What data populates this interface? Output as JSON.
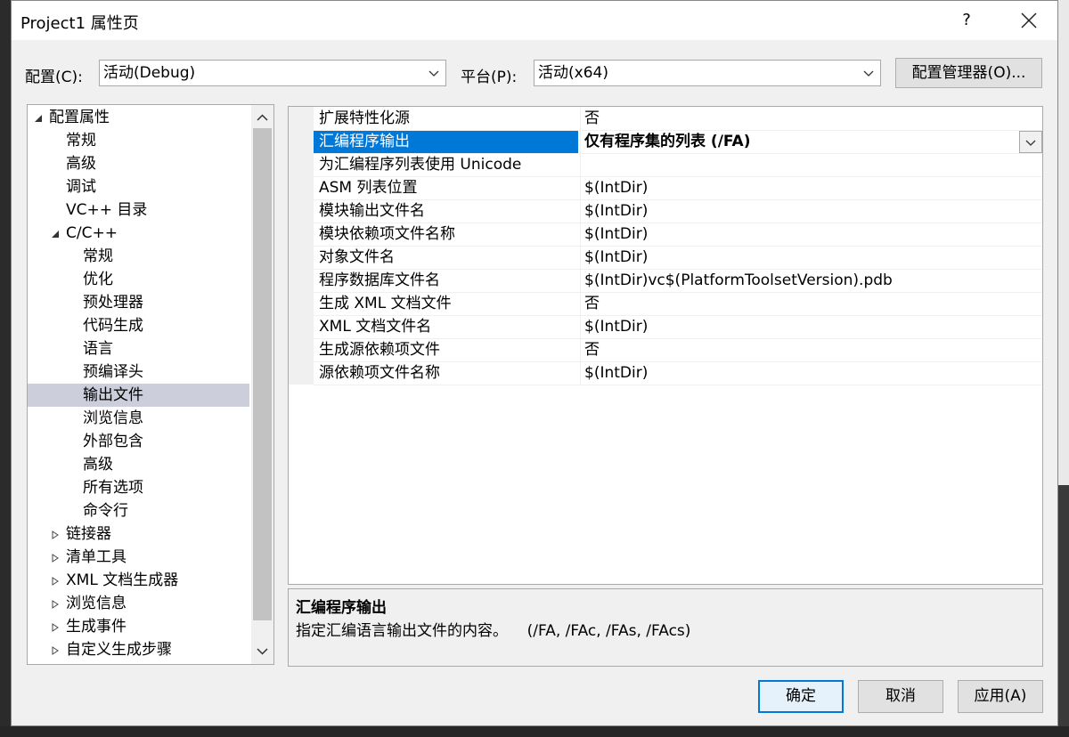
{
  "window": {
    "title": "Project1 属性页",
    "help": "?"
  },
  "config": {
    "label": "配置(C):",
    "value": "活动(Debug)",
    "platform_label": "平台(P):",
    "platform_value": "活动(x64)",
    "manager_button": "配置管理器(O)..."
  },
  "tree": {
    "items": [
      {
        "label": "配置属性",
        "expander": "expanded"
      },
      {
        "label": "常规"
      },
      {
        "label": "高级"
      },
      {
        "label": "调试"
      },
      {
        "label": "VC++ 目录"
      },
      {
        "label": "C/C++",
        "expander": "expanded"
      },
      {
        "label": "常规"
      },
      {
        "label": "优化"
      },
      {
        "label": "预处理器"
      },
      {
        "label": "代码生成"
      },
      {
        "label": "语言"
      },
      {
        "label": "预编译头"
      },
      {
        "label": "输出文件",
        "selected": true
      },
      {
        "label": "浏览信息"
      },
      {
        "label": "外部包含"
      },
      {
        "label": "高级"
      },
      {
        "label": "所有选项"
      },
      {
        "label": "命令行"
      },
      {
        "label": "链接器",
        "expander": "collapsed"
      },
      {
        "label": "清单工具",
        "expander": "collapsed"
      },
      {
        "label": "XML 文档生成器",
        "expander": "collapsed"
      },
      {
        "label": "浏览信息",
        "expander": "collapsed"
      },
      {
        "label": "生成事件",
        "expander": "collapsed"
      },
      {
        "label": "自定义生成步骤",
        "expander": "collapsed"
      }
    ]
  },
  "properties": {
    "rows": [
      {
        "name": "扩展特性化源",
        "value": "否"
      },
      {
        "name": "汇编程序输出",
        "value": "仅有程序集的列表 (/FA)",
        "selected": true
      },
      {
        "name": "为汇编程序列表使用 Unicode",
        "value": ""
      },
      {
        "name": "ASM 列表位置",
        "value": "$(IntDir)"
      },
      {
        "name": "模块输出文件名",
        "value": "$(IntDir)"
      },
      {
        "name": "模块依赖项文件名称",
        "value": "$(IntDir)"
      },
      {
        "name": "对象文件名",
        "value": "$(IntDir)"
      },
      {
        "name": "程序数据库文件名",
        "value": "$(IntDir)vc$(PlatformToolsetVersion).pdb"
      },
      {
        "name": "生成 XML 文档文件",
        "value": "否"
      },
      {
        "name": "XML 文档文件名",
        "value": "$(IntDir)"
      },
      {
        "name": "生成源依赖项文件",
        "value": "否"
      },
      {
        "name": "源依赖项文件名称",
        "value": "$(IntDir)"
      }
    ]
  },
  "description": {
    "title": "汇编程序输出",
    "text": "指定汇编语言输出文件的内容。    (/FA, /FAc, /FAs, /FAcs)"
  },
  "buttons": {
    "ok": "确定",
    "cancel": "取消",
    "apply": "应用(A)"
  },
  "colors": {
    "selection": "#0078d7",
    "tree_selection": "#cccedb",
    "dialog_bg": "#f0f0f0"
  }
}
